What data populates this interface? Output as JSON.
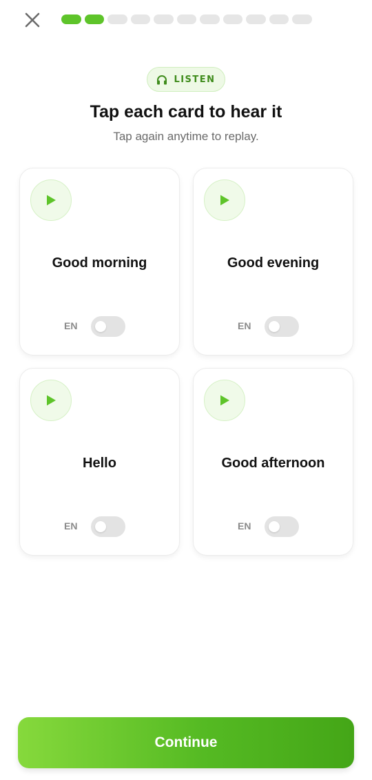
{
  "header": {
    "progress": {
      "total_steps": 11,
      "completed_steps": 2
    },
    "badge_label": "LISTEN",
    "badge_icon": "headphones-icon",
    "title": "Tap each card to hear it",
    "subtitle": "Tap again anytime to replay."
  },
  "cards": [
    {
      "phrase": "Good morning",
      "lang": "EN",
      "toggle_on": false
    },
    {
      "phrase": "Good evening",
      "lang": "EN",
      "toggle_on": false
    },
    {
      "phrase": "Hello",
      "lang": "EN",
      "toggle_on": false
    },
    {
      "phrase": "Good afternoon",
      "lang": "EN",
      "toggle_on": false
    }
  ],
  "footer": {
    "continue_label": "Continue"
  },
  "colors": {
    "accent": "#5ec42a",
    "accent_dark": "#3f8c1c",
    "track": "#e6e6e6",
    "text": "#111111",
    "muted": "#6a6a6a"
  }
}
